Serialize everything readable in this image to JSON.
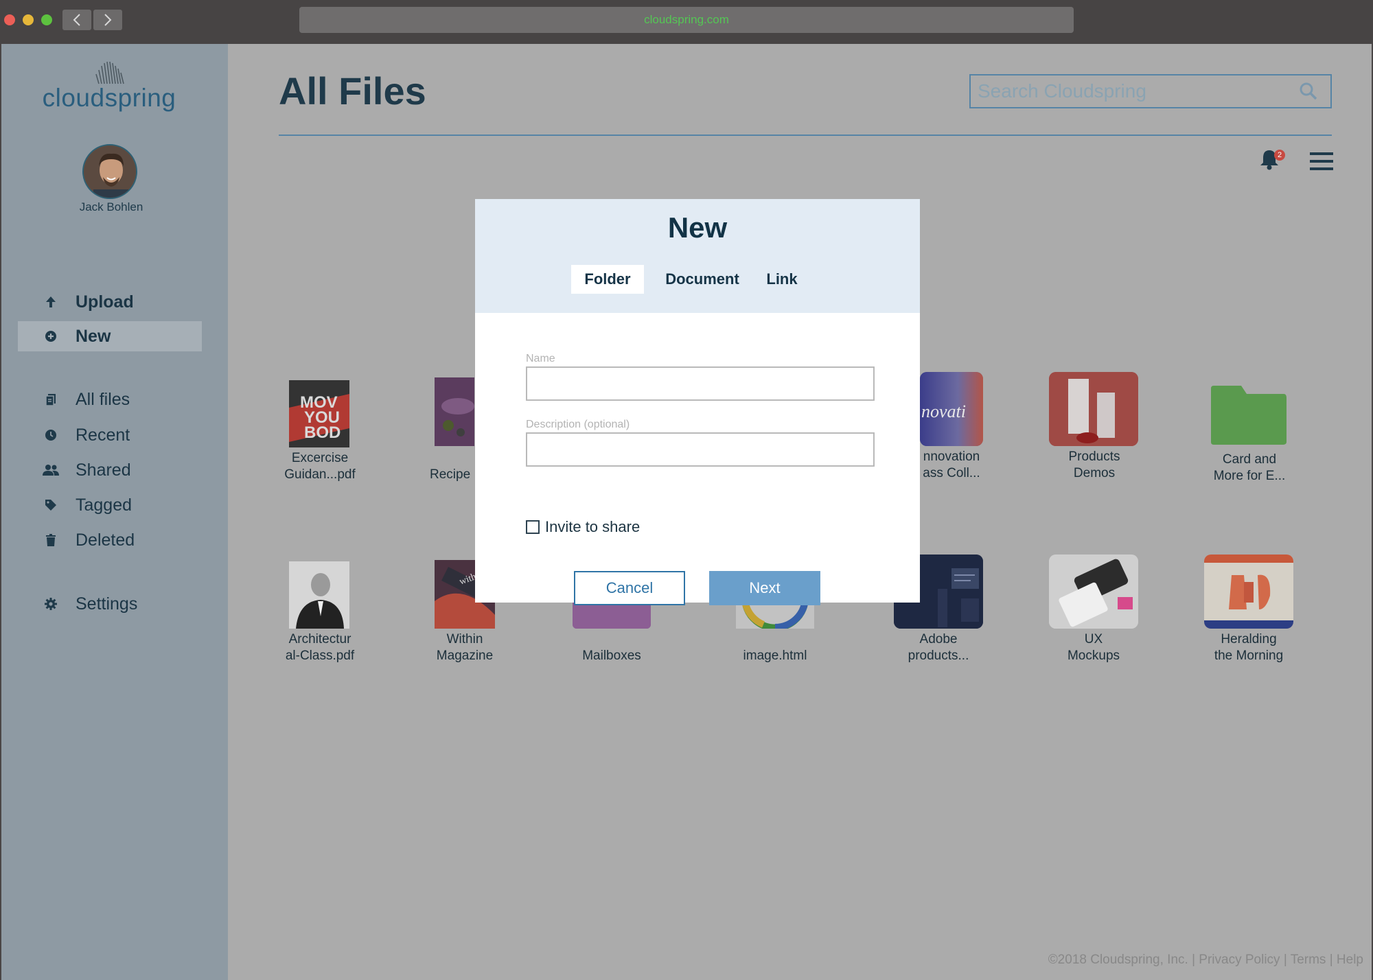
{
  "browser": {
    "url": "cloudspring.com"
  },
  "brand": {
    "name": "cloudspring",
    "accent": "#2a5e7e"
  },
  "user": {
    "name": "Jack Bohlen"
  },
  "sidebar": {
    "actions": [
      {
        "label": "Upload",
        "icon": "arrow-up-icon"
      },
      {
        "label": "New",
        "icon": "plus-circle-icon",
        "active": true
      }
    ],
    "items": [
      {
        "label": "All files",
        "icon": "files-icon"
      },
      {
        "label": "Recent",
        "icon": "clock-icon"
      },
      {
        "label": "Shared",
        "icon": "users-icon"
      },
      {
        "label": "Tagged",
        "icon": "tag-icon"
      },
      {
        "label": "Deleted",
        "icon": "trash-icon"
      }
    ],
    "settings": {
      "label": "Settings",
      "icon": "gear-icon"
    }
  },
  "main": {
    "title": "All Files",
    "search_placeholder": "Search Cloudspring",
    "notifications_count": "2"
  },
  "files": [
    {
      "line1": "Excercise",
      "line2": "Guidan...pdf"
    },
    {
      "line1": "Recipe",
      "line2": ""
    },
    {
      "line1": "nnovation",
      "line2": "ass Coll..."
    },
    {
      "line1": "Products",
      "line2": "Demos"
    },
    {
      "line1": "Card and",
      "line2": "More for E..."
    },
    {
      "line1": "Architectur",
      "line2": "al-Class.pdf"
    },
    {
      "line1": "Within",
      "line2": "Magazine"
    },
    {
      "line1": "Mailboxes",
      "line2": ""
    },
    {
      "line1": "image.html",
      "line2": ""
    },
    {
      "line1": "Adobe",
      "line2": "products..."
    },
    {
      "line1": "UX",
      "line2": "Mockups"
    },
    {
      "line1": "Heralding",
      "line2": "the Morning"
    }
  ],
  "modal": {
    "title": "New",
    "tabs": [
      "Folder",
      "Document",
      "Link"
    ],
    "active_tab": "Folder",
    "name_label": "Name",
    "name_value": "",
    "description_label": "Description (optional)",
    "description_value": "",
    "invite_label": "Invite to share",
    "invite_checked": false,
    "cancel_label": "Cancel",
    "next_label": "Next"
  },
  "footer": {
    "text": "©2018 Cloudspring, Inc. | Privacy Policy | Terms | Help"
  }
}
